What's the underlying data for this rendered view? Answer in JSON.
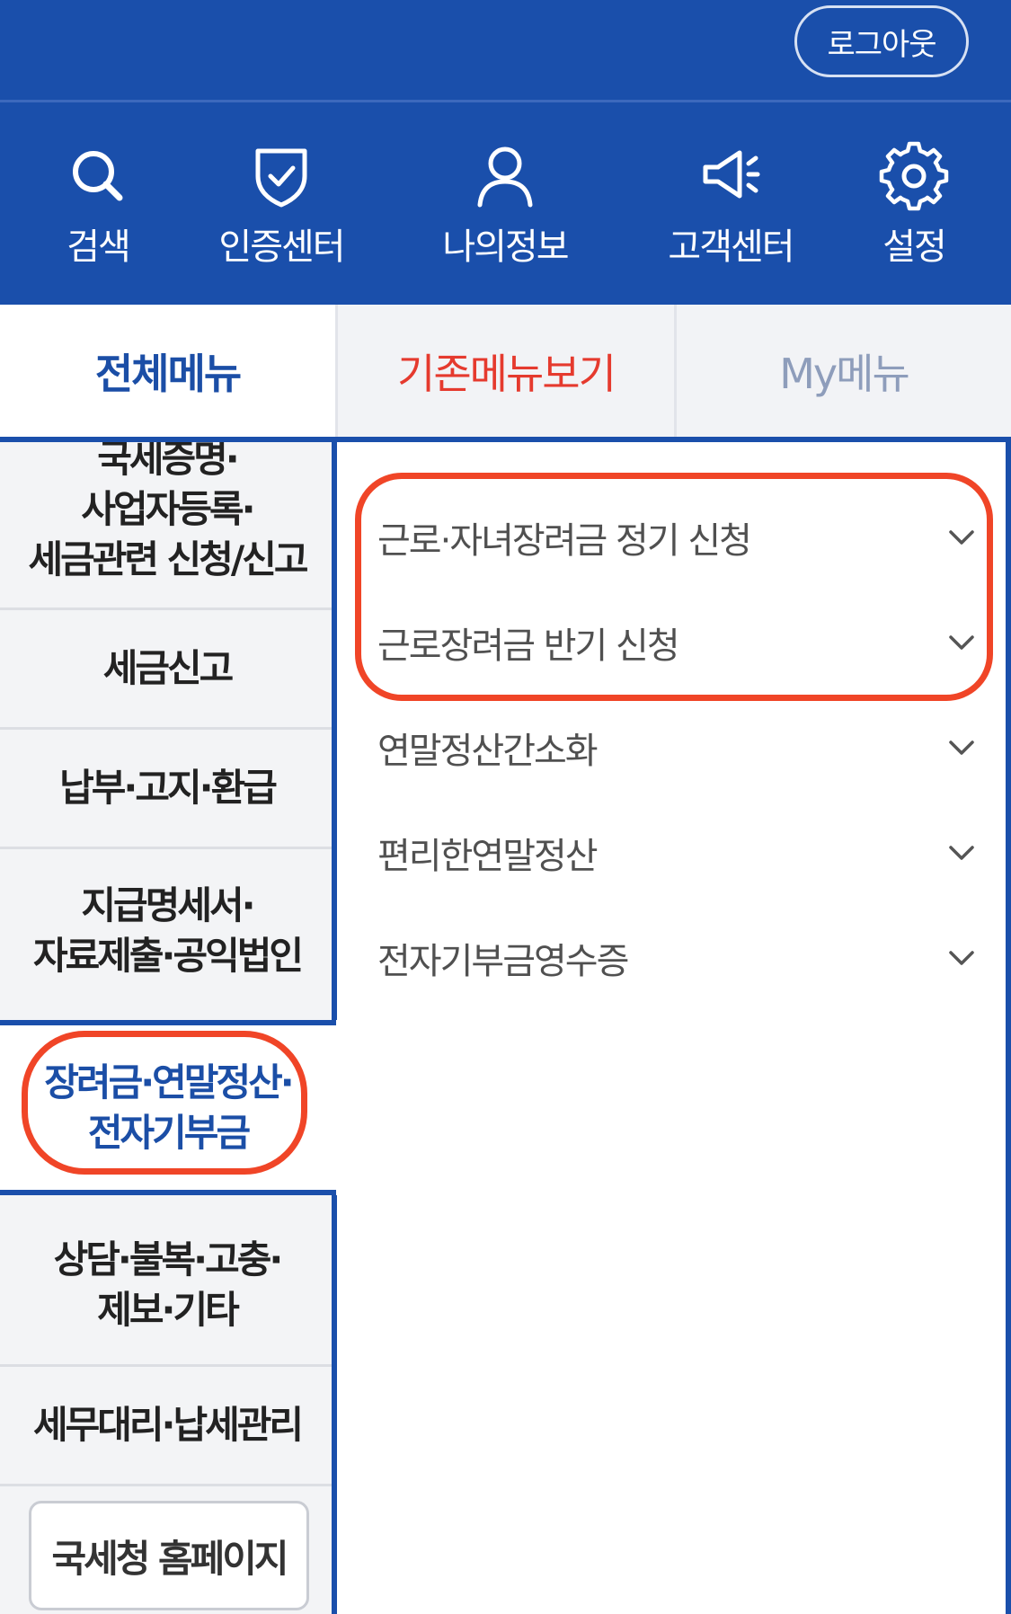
{
  "header": {
    "logout_label": "로그아웃"
  },
  "icon_bar": {
    "items": [
      {
        "label": "검색",
        "icon": "search-icon"
      },
      {
        "label": "인증센터",
        "icon": "shield-check-icon"
      },
      {
        "label": "나의정보",
        "icon": "person-icon"
      },
      {
        "label": "고객센터",
        "icon": "megaphone-icon"
      },
      {
        "label": "설정",
        "icon": "gear-icon"
      }
    ]
  },
  "tabs": [
    {
      "label": "전체메뉴",
      "state": "active"
    },
    {
      "label": "기존메뉴보기",
      "state": "inactive"
    },
    {
      "label": "My메뉴",
      "state": "inactive"
    }
  ],
  "sidebar": {
    "items": [
      {
        "line1": "국세증명·",
        "line2": "사업자등록·",
        "line3": "세금관련 신청/신고"
      },
      {
        "line1": "세금신고"
      },
      {
        "line1": "납부·고지·환급"
      },
      {
        "line1": "지급명세서·",
        "line2": "자료제출·공익법인"
      },
      {
        "line1": "장려금·연말정산·",
        "line2": "전자기부금",
        "selected": true
      },
      {
        "line1": "상담·불복·고충·",
        "line2": "제보·기타"
      },
      {
        "line1": "세무대리·납세관리"
      }
    ],
    "homepage_button": "국세청 홈페이지"
  },
  "submenu": {
    "items": [
      {
        "label": "근로·자녀장려금 정기 신청"
      },
      {
        "label": "근로장려금 반기 신청"
      },
      {
        "label": "연말정산간소화"
      },
      {
        "label": "편리한연말정산"
      },
      {
        "label": "전자기부금영수증"
      }
    ]
  },
  "colors": {
    "brand_blue": "#1a4fab",
    "highlight_red": "#f04527",
    "tab_old_red": "#e53a2e"
  }
}
